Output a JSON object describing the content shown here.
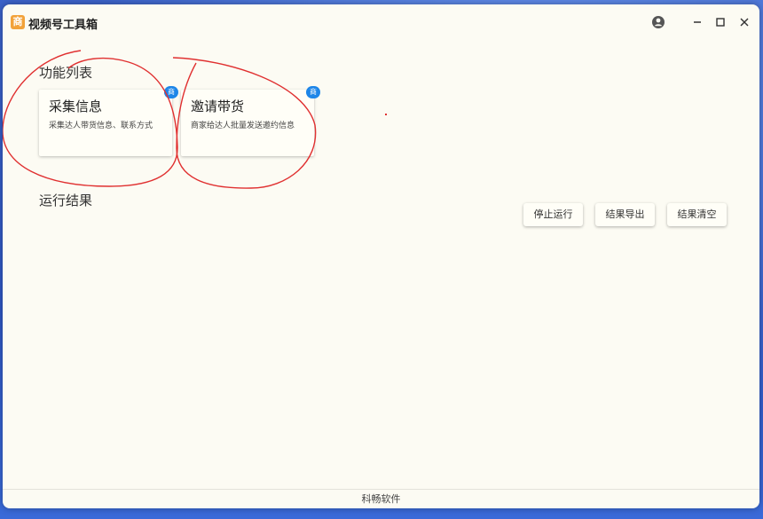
{
  "app": {
    "title": "视频号工具箱",
    "logo_char": "商"
  },
  "sections": {
    "functions": "功能列表",
    "results": "运行结果"
  },
  "cards": [
    {
      "title": "采集信息",
      "desc": "采集达人带货信息、联系方式",
      "badge": "商"
    },
    {
      "title": "邀请带货",
      "desc": "商家给达人批量发送邀约信息",
      "badge": "商"
    }
  ],
  "actions": {
    "stop": "停止运行",
    "export": "结果导出",
    "clear": "结果清空"
  },
  "footer": {
    "text": "科畅软件"
  },
  "icons": [
    "account-icon",
    "minimize-icon",
    "maximize-icon",
    "close-icon"
  ],
  "colors": {
    "badge": "#1e86e8",
    "logo": "#f2a23a",
    "annotation": "#e03030",
    "window_bg": "#fcfbf3"
  }
}
